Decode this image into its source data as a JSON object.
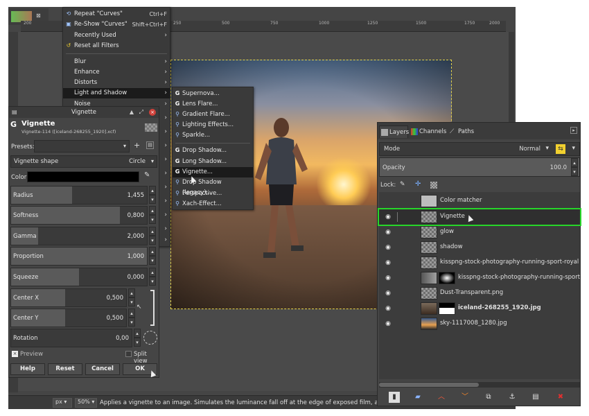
{
  "ruler": {
    "ticks": [
      "200",
      "250",
      "500",
      "750",
      "1000",
      "1250",
      "1500",
      "1750",
      "2000"
    ]
  },
  "status": {
    "unit": "px",
    "zoom": "50%",
    "message": "Applies a vignette to an image. Simulates the luminance fall off at the edge of exposed film, and some other fuzzier l"
  },
  "filters_menu": {
    "repeat": {
      "label": "Repeat \"Curves\"",
      "shortcut": "Ctrl+F"
    },
    "reshow": {
      "label": "Re-Show \"Curves\"",
      "shortcut": "Shift+Ctrl+F"
    },
    "recently": "Recently Used",
    "reset": "Reset all Filters",
    "blur": "Blur",
    "enhance": "Enhance",
    "distorts": "Distorts",
    "light_shadow": "Light and Shadow",
    "noise": "Noise"
  },
  "ls_menu": {
    "items": [
      "Supernova...",
      "Lens Flare...",
      "Gradient Flare...",
      "Lighting Effects...",
      "Sparkle...",
      "Drop Shadow...",
      "Long Shadow...",
      "Vignette...",
      "Drop Shadow (legacy)...",
      "Perspective...",
      "Xach-Effect..."
    ]
  },
  "vignette": {
    "window_title": "Vignette",
    "title": "Vignette",
    "subtitle": "Vignette-114 ([iceland-268255_1920].xcf)",
    "presets_label": "Presets:",
    "shape_label": "Vignette shape",
    "shape_value": "Circle",
    "color_label": "Color",
    "color_value": "#000000",
    "params": [
      {
        "label": "Radius",
        "value": "1,455",
        "fraction": 0.45
      },
      {
        "label": "Softness",
        "value": "0,800",
        "fraction": 0.8
      },
      {
        "label": "Gamma",
        "value": "2,000",
        "fraction": 0.2
      },
      {
        "label": "Proportion",
        "value": "1,000",
        "fraction": 1.0
      },
      {
        "label": "Squeeze",
        "value": "0,000",
        "fraction": 0.5
      }
    ],
    "center_x": {
      "label": "Center X",
      "value": "0,500"
    },
    "center_y": {
      "label": "Center Y",
      "value": "0,500"
    },
    "rotation": {
      "label": "Rotation",
      "value": "0,00"
    },
    "preview": "Preview",
    "split_view": "Split view",
    "buttons": {
      "help": "Help",
      "reset": "Reset",
      "cancel": "Cancel",
      "ok": "OK"
    }
  },
  "layers": {
    "tabs": {
      "layers": "Layers",
      "channels": "Channels",
      "paths": "Paths"
    },
    "mode_label": "Mode",
    "mode_value": "Normal",
    "opacity_label": "Opacity",
    "opacity_value": "100.0",
    "lock_label": "Lock:",
    "items": [
      {
        "name": "Color matcher",
        "visible": false
      },
      {
        "name": "Vignette",
        "visible": true,
        "selected": true
      },
      {
        "name": "glow",
        "visible": true
      },
      {
        "name": "shadow",
        "visible": true
      },
      {
        "name": "kisspng-stock-photography-running-sport-royalty-free",
        "visible": true
      },
      {
        "name": "kisspng-stock-photography-running-sport-roya",
        "visible": true
      },
      {
        "name": "Dust-Transparent.png",
        "visible": true
      },
      {
        "name": "iceland-268255_1920.jpg",
        "visible": true,
        "bold": true
      },
      {
        "name": "sky-1117008_1280.jpg",
        "visible": true
      }
    ]
  }
}
